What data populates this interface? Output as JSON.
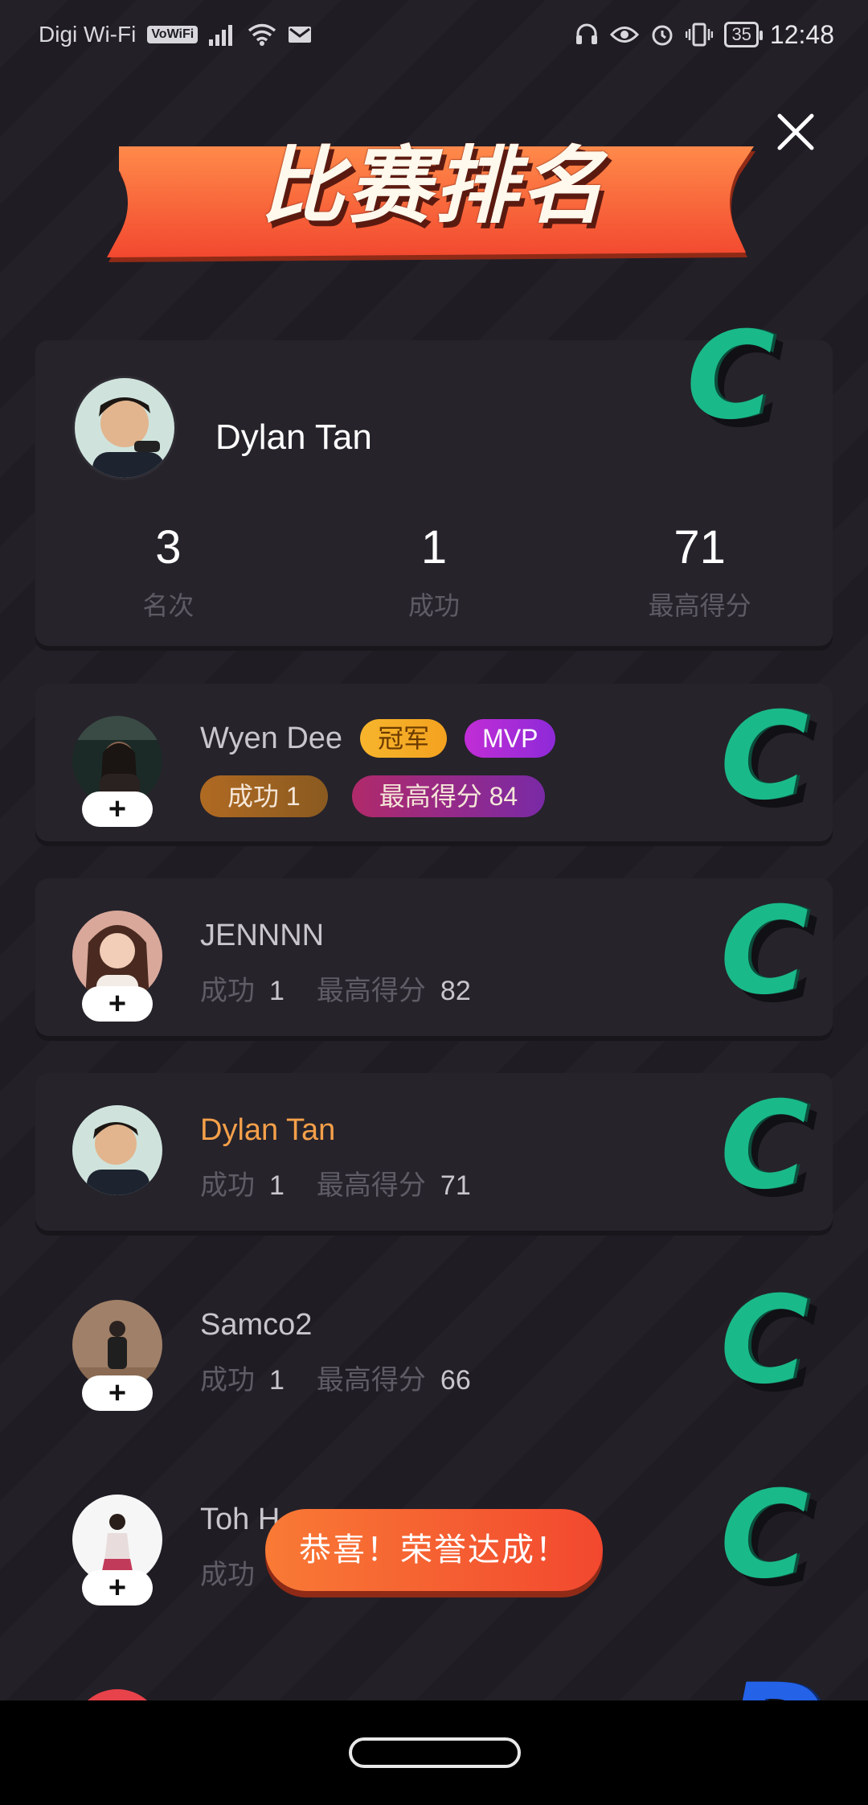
{
  "status_bar": {
    "carrier": "Digi Wi-Fi",
    "vowifi": "VoWiFi",
    "battery": "35",
    "time": "12:48"
  },
  "header": {
    "title": "比赛排名"
  },
  "my_summary": {
    "name": "Dylan Tan",
    "grade": "C",
    "stats": [
      {
        "value": "3",
        "label": "名次"
      },
      {
        "value": "1",
        "label": "成功"
      },
      {
        "value": "71",
        "label": "最高得分"
      }
    ]
  },
  "ranking": [
    {
      "name": "Wyen Dee",
      "badge_champion": "冠军",
      "badge_mvp": "MVP",
      "success_label": "成功",
      "success": "1",
      "high_label": "最高得分",
      "high": "84",
      "grade": "C"
    },
    {
      "name": "JENNNN",
      "success_label": "成功",
      "success": "1",
      "high_label": "最高得分",
      "high": "82",
      "grade": "C"
    },
    {
      "name": "Dylan Tan",
      "success_label": "成功",
      "success": "1",
      "high_label": "最高得分",
      "high": "71",
      "grade": "C"
    },
    {
      "name": "Samco2",
      "success_label": "成功",
      "success": "1",
      "high_label": "最高得分",
      "high": "66",
      "grade": "C"
    },
    {
      "name": "Toh H",
      "success_label": "成功",
      "grade": "C"
    },
    {
      "name": "",
      "grade": "D"
    }
  ],
  "add_button": "+",
  "toast": "恭喜！荣誉达成！",
  "colors": {
    "background": "#1f1c24",
    "card": "#26232b",
    "accent_orange": "#f5a04a",
    "grade_green": "#1ab98a",
    "toast": "#f2482f"
  }
}
